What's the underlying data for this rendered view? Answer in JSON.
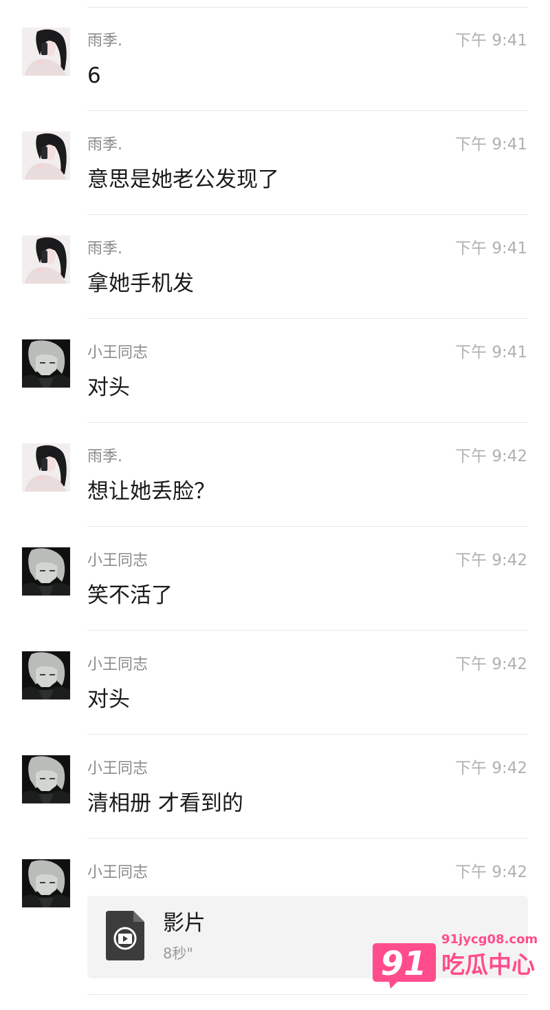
{
  "messages": [
    {
      "sender": "雨季.",
      "time": "下午 9:41",
      "text": "6",
      "avatar": "girl-avatar"
    },
    {
      "sender": "雨季.",
      "time": "下午 9:41",
      "text": "意思是她老公发现了",
      "avatar": "girl-avatar"
    },
    {
      "sender": "雨季.",
      "time": "下午 9:41",
      "text": "拿她手机发",
      "avatar": "girl-avatar"
    },
    {
      "sender": "小王同志",
      "time": "下午 9:41",
      "text": "对头",
      "avatar": "anime-avatar"
    },
    {
      "sender": "雨季.",
      "time": "下午 9:42",
      "text": "想让她丢脸？",
      "avatar": "girl-avatar"
    },
    {
      "sender": "小王同志",
      "time": "下午 9:42",
      "text": "笑不活了",
      "avatar": "anime-avatar"
    },
    {
      "sender": "小王同志",
      "time": "下午 9:42",
      "text": "对头",
      "avatar": "anime-avatar"
    },
    {
      "sender": "小王同志",
      "time": "下午 9:42",
      "text": "清相册 才看到的",
      "avatar": "anime-avatar"
    },
    {
      "sender": "小王同志",
      "time": "下午 9:42",
      "avatar": "anime-avatar",
      "file": {
        "name": "影片",
        "duration": "8秒\"",
        "icon": "video-file-icon"
      }
    }
  ],
  "watermark": {
    "badge": "91",
    "url": "91jycg08.com",
    "name": "吃瓜中心",
    "color": "#ff4d8c"
  }
}
